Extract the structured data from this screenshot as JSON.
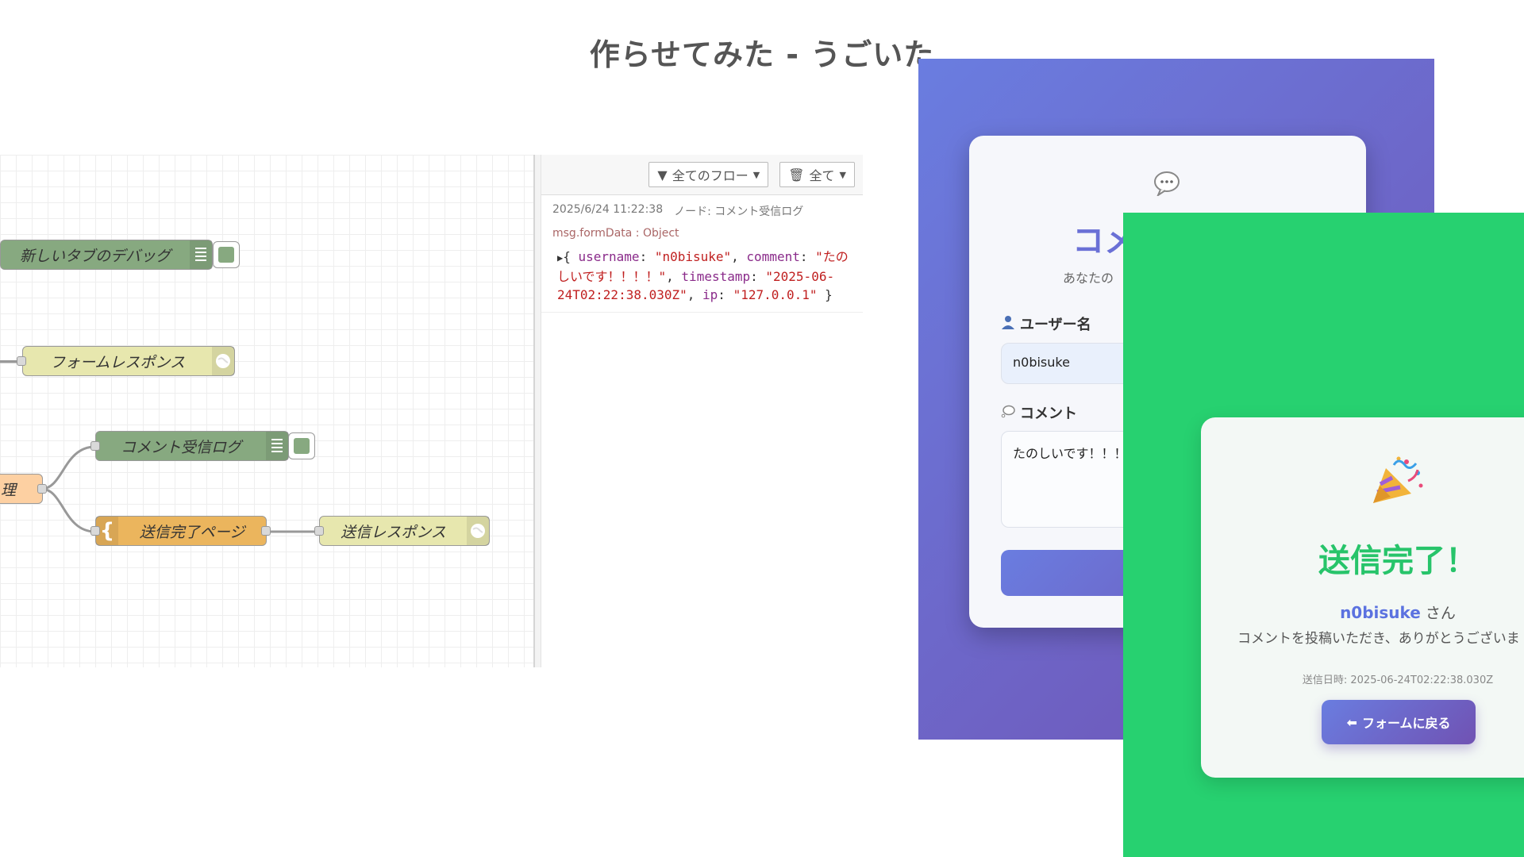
{
  "slide": {
    "title": "作らせてみた - うごいた"
  },
  "flow": {
    "nodes": {
      "debug_tab": "新しいタブのデバッグ",
      "form_response": "フォームレスポンス",
      "partial_left": "理",
      "comment_log": "コメント受信ログ",
      "complete_page": "送信完了ページ",
      "send_response": "送信レスポンス"
    }
  },
  "debug": {
    "filter_label": "全てのフロー",
    "clear_label": "全て",
    "message": {
      "timestamp": "2025/6/24 11:22:38",
      "node": "ノード: コメント受信ログ",
      "topic": "msg.formData : Object",
      "payload": {
        "username_key": "username",
        "username_val": "\"n0bisuke\"",
        "comment_key": "comment",
        "comment_val": "\"たのしいです！！！！\"",
        "timestamp_key": "timestamp",
        "timestamp_val": "\"2025-06-24T02:22:38.030Z\"",
        "ip_key": "ip",
        "ip_val": "\"127.0.0.1\""
      }
    }
  },
  "form": {
    "heading_partial": "コメ",
    "subtitle_partial": "あなたの",
    "username_label": "ユーザー名",
    "username_value": "n0bisuke",
    "comment_label": "コメント",
    "comment_value": "たのしいです！！！",
    "icons": {
      "header": "speech-bubble-icon",
      "user": "user-icon",
      "comment": "thought-bubble-icon"
    }
  },
  "success": {
    "title": "送信完了！",
    "username": "n0bisuke",
    "honorific": "さん",
    "message": "コメントを投稿いただき、ありがとうございま",
    "sent_at": "送信日時: 2025-06-24T02:22:38.030Z",
    "back_button": "フォームに戻る",
    "icons": {
      "celebration": "party-popper-icon",
      "back": "back-arrow-icon"
    }
  },
  "colors": {
    "form_gradient_start": "#6a7de0",
    "form_gradient_end": "#7052b3",
    "success_bg": "#27d170",
    "success_title": "#27c46a",
    "username_accent": "#5b72e0"
  }
}
